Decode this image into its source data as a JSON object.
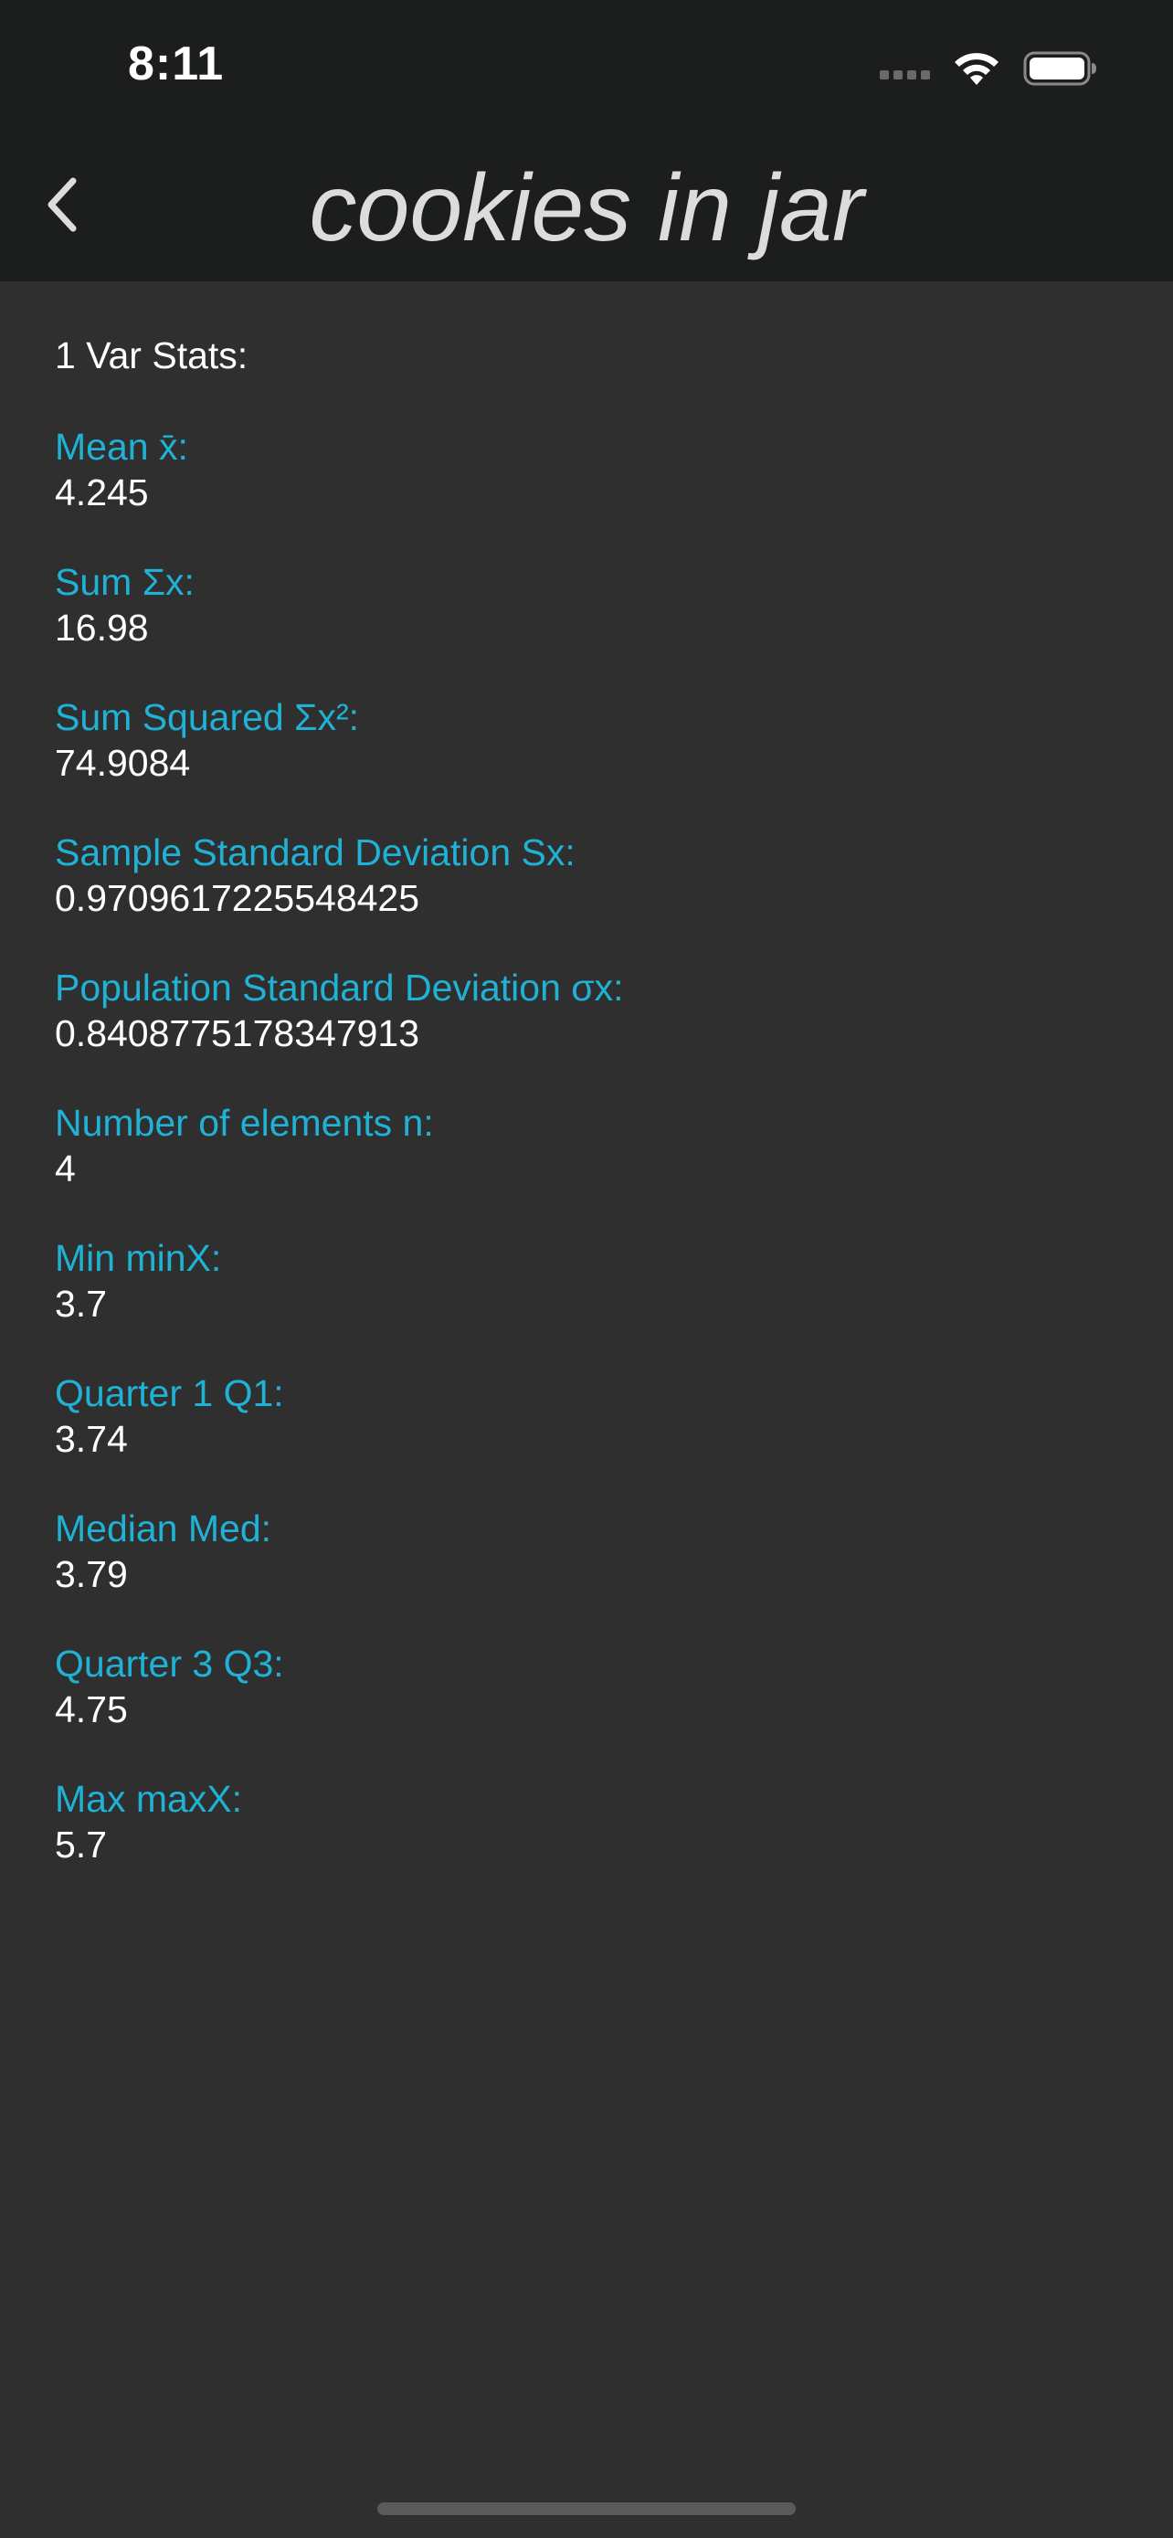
{
  "status_bar": {
    "time": "8:11"
  },
  "nav": {
    "back_icon": "chevron-left-icon",
    "title": "cookies in jar"
  },
  "stats": {
    "heading": "1 Var Stats:",
    "items": [
      {
        "label": "Mean x̄:",
        "value": "4.245"
      },
      {
        "label": "Sum Σx:",
        "value": "16.98"
      },
      {
        "label": "Sum Squared Σx²:",
        "value": "74.9084"
      },
      {
        "label": "Sample Standard Deviation Sx:",
        "value": "0.9709617225548425"
      },
      {
        "label": "Population Standard Deviation σx:",
        "value": "0.8408775178347913"
      },
      {
        "label": "Number of elements n:",
        "value": "4"
      },
      {
        "label": "Min minX:",
        "value": "3.7"
      },
      {
        "label": "Quarter 1 Q1:",
        "value": "3.74"
      },
      {
        "label": "Median Med:",
        "value": "3.79"
      },
      {
        "label": "Quarter 3 Q3:",
        "value": "4.75"
      },
      {
        "label": "Max maxX:",
        "value": "5.7"
      }
    ]
  },
  "colors": {
    "background": "#2f2f30",
    "header": "#1c1d1d",
    "label": "#1fb2d5",
    "value": "#ffffff"
  }
}
